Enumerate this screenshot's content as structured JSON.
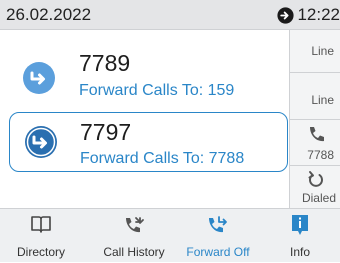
{
  "status": {
    "date": "26.02.2022",
    "time": "12:22",
    "icon": "clock-icon"
  },
  "lines": [
    {
      "number": "7789",
      "forward_text": "Forward Calls To: 159",
      "icon": "forward-arrow-icon"
    },
    {
      "number": "7797",
      "forward_text": "Forward Calls To: 7788",
      "icon": "forward-arrow-icon",
      "selected": true
    }
  ],
  "side_keys": [
    {
      "label": "Line"
    },
    {
      "label": "Line"
    },
    {
      "label": "7788",
      "icon": "phone-icon"
    },
    {
      "label": "Dialed",
      "icon": "redial-icon"
    }
  ],
  "softkeys": [
    {
      "label": "Directory",
      "icon": "book-icon"
    },
    {
      "label": "Call History",
      "icon": "call-history-icon"
    },
    {
      "label": "Forward Off",
      "icon": "forward-phone-icon"
    },
    {
      "label": "Info",
      "icon": "info-icon"
    }
  ],
  "colors": {
    "accent": "#2a86c8",
    "avatar": "#5b9fdc",
    "status_bar": "#e4e5e7"
  }
}
